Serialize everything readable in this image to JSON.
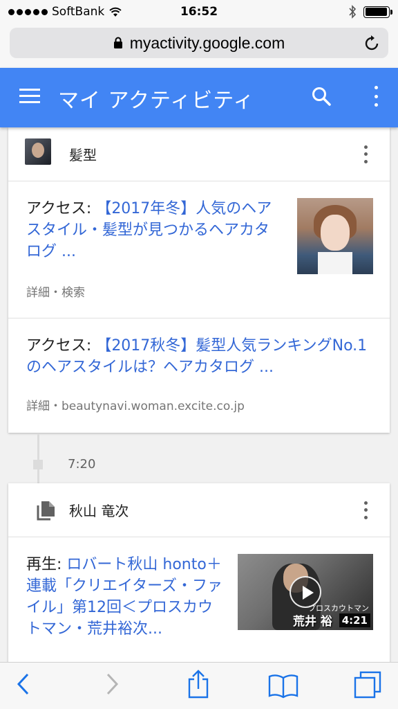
{
  "status": {
    "carrier": "SoftBank",
    "time": "16:52",
    "battery_level": 0.95
  },
  "browser": {
    "url": "myactivity.google.com"
  },
  "appbar": {
    "title": "マイ アクティビティ"
  },
  "card1": {
    "header": "髪型",
    "items": [
      {
        "prefix": "アクセス: ",
        "link": "【2017年冬】人気のヘアスタイル・髪型が見つかるヘアカタログ ...",
        "meta": "詳細・検索"
      },
      {
        "prefix": "アクセス: ",
        "link": "【2017秋冬】髪型人気ランキングNo.1のヘアスタイルは？ヘアカタログ ...",
        "meta": "詳細・beautynavi.woman.excite.co.jp"
      }
    ]
  },
  "timeline": {
    "time": "7:20"
  },
  "card2": {
    "header": "秋山 竜次",
    "items": [
      {
        "prefix": "再生: ",
        "link": "ロバート秋山 honto＋連載「クリエイターズ・ファイル」第12回＜プロスカウトマン・荒井裕次...",
        "video_duration": "4:21",
        "thumb_caption": "プロスカウトマン",
        "thumb_name": "荒井 裕"
      }
    ]
  },
  "icons": {
    "lock": "lock-icon",
    "reload": "reload-icon",
    "menu": "menu-icon",
    "search": "search-icon",
    "more": "more-vert-icon",
    "doc": "document-icon"
  }
}
